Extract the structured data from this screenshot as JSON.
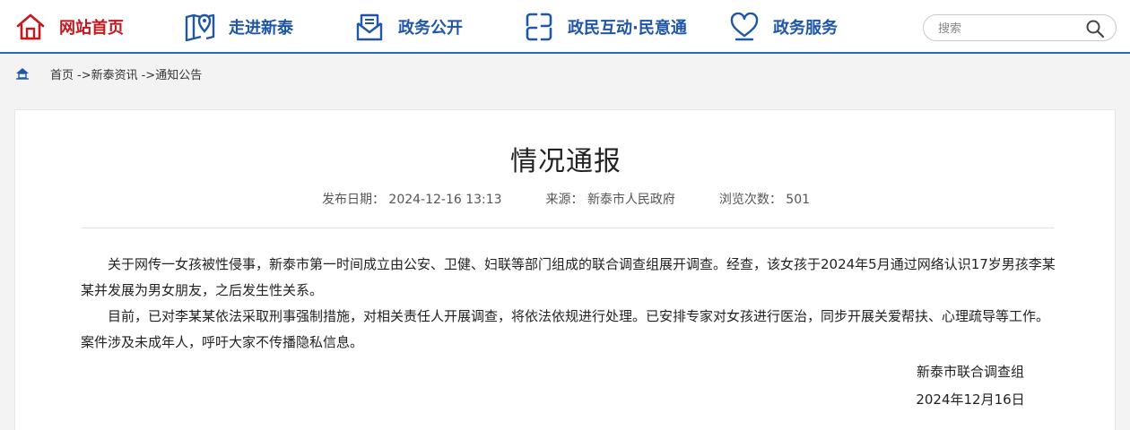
{
  "nav": {
    "items": [
      {
        "label": "网站首页",
        "icon": "home-icon"
      },
      {
        "label": "走进新泰",
        "icon": "map-pin-icon"
      },
      {
        "label": "政务公开",
        "icon": "mail-icon"
      },
      {
        "label": "政民互动·民意通",
        "icon": "interaction-icon"
      },
      {
        "label": "政务服务",
        "icon": "heart-icon"
      }
    ],
    "search_placeholder": "搜索",
    "active_color": "#c8161d",
    "accent_color": "#1f56a8"
  },
  "breadcrumb": {
    "items": [
      "首页",
      "->新泰资讯",
      "->通知公告"
    ]
  },
  "article": {
    "title": "情况通报",
    "meta": {
      "date_label": "发布日期：",
      "date": "2024-12-16 13:13",
      "source_label": "来源：",
      "source": "新泰市人民政府",
      "views_label": "浏览次数：",
      "views": "501"
    },
    "paragraphs": [
      "关于网传一女孩被性侵事，新泰市第一时间成立由公安、卫健、妇联等部门组成的联合调查组展开调查。经查，该女孩于2024年5月通过网络认识17岁男孩李某某并发展为男女朋友，之后发生性关系。",
      "目前，已对李某某依法采取刑事强制措施，对相关责任人开展调查，将依法依规进行处理。已安排专家对女孩进行医治，同步开展关爱帮扶、心理疏导等工作。 案件涉及未成年人，呼吁大家不传播隐私信息。"
    ],
    "signature": {
      "org": "新泰市联合调查组",
      "date": "2024年12月16日"
    }
  }
}
